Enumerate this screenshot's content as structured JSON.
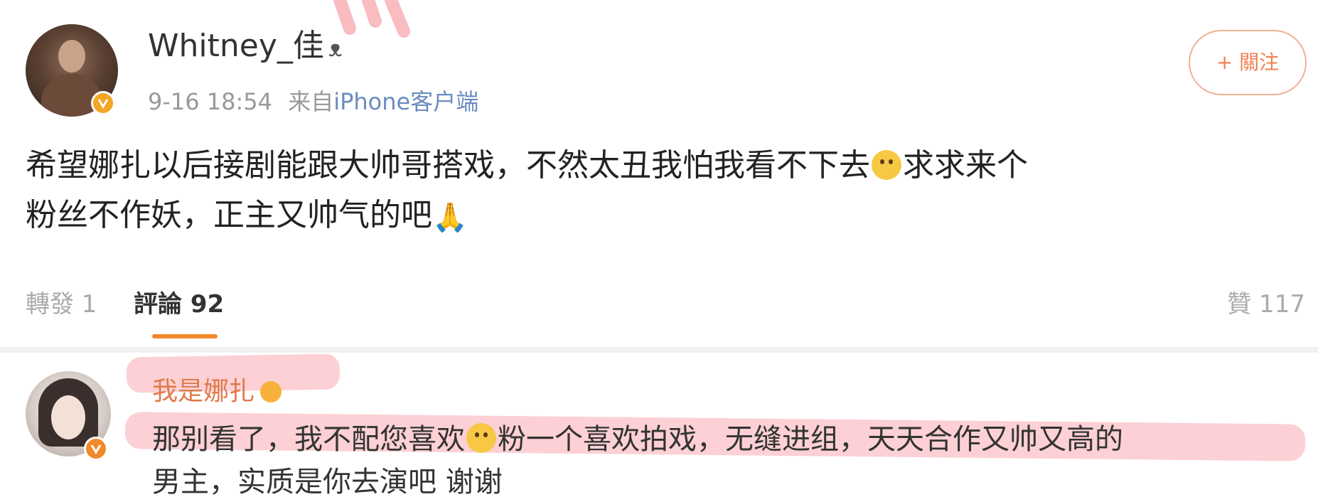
{
  "post": {
    "username": "Whitney_佳",
    "username_icon": "panda-face-icon",
    "time": "9-16 18:54",
    "source_prefix": "来自",
    "source": "iPhone客户端",
    "follow_label": "+ 關注",
    "text_line1": "希望娜扎以后接剧能跟大帅哥搭戏，不然太丑我怕我看不下去",
    "text_line1_end": "求求来个",
    "text_line2": "粉丝不作妖，正主又帅气的吧",
    "emoji1": "smile-emoji",
    "emoji2": "pray-emoji"
  },
  "tabs": {
    "repost": "轉發 1",
    "comment": "評論 92",
    "like": "贊 117"
  },
  "comment": {
    "username": "我是娜扎",
    "username_icon": "emoji-icon",
    "text_part1": "那别看了，我不配您喜欢",
    "text_part2": "粉一个喜欢拍戏，无缝进组，天天合作又帅又高的",
    "text_line2": "男主，实质是你去演吧 谢谢"
  },
  "colors": {
    "accent_orange": "#f08a2c",
    "highlight_pink": "#f896a0",
    "link_blue": "#6a8bbf",
    "verified_gold": "#f5a623"
  }
}
